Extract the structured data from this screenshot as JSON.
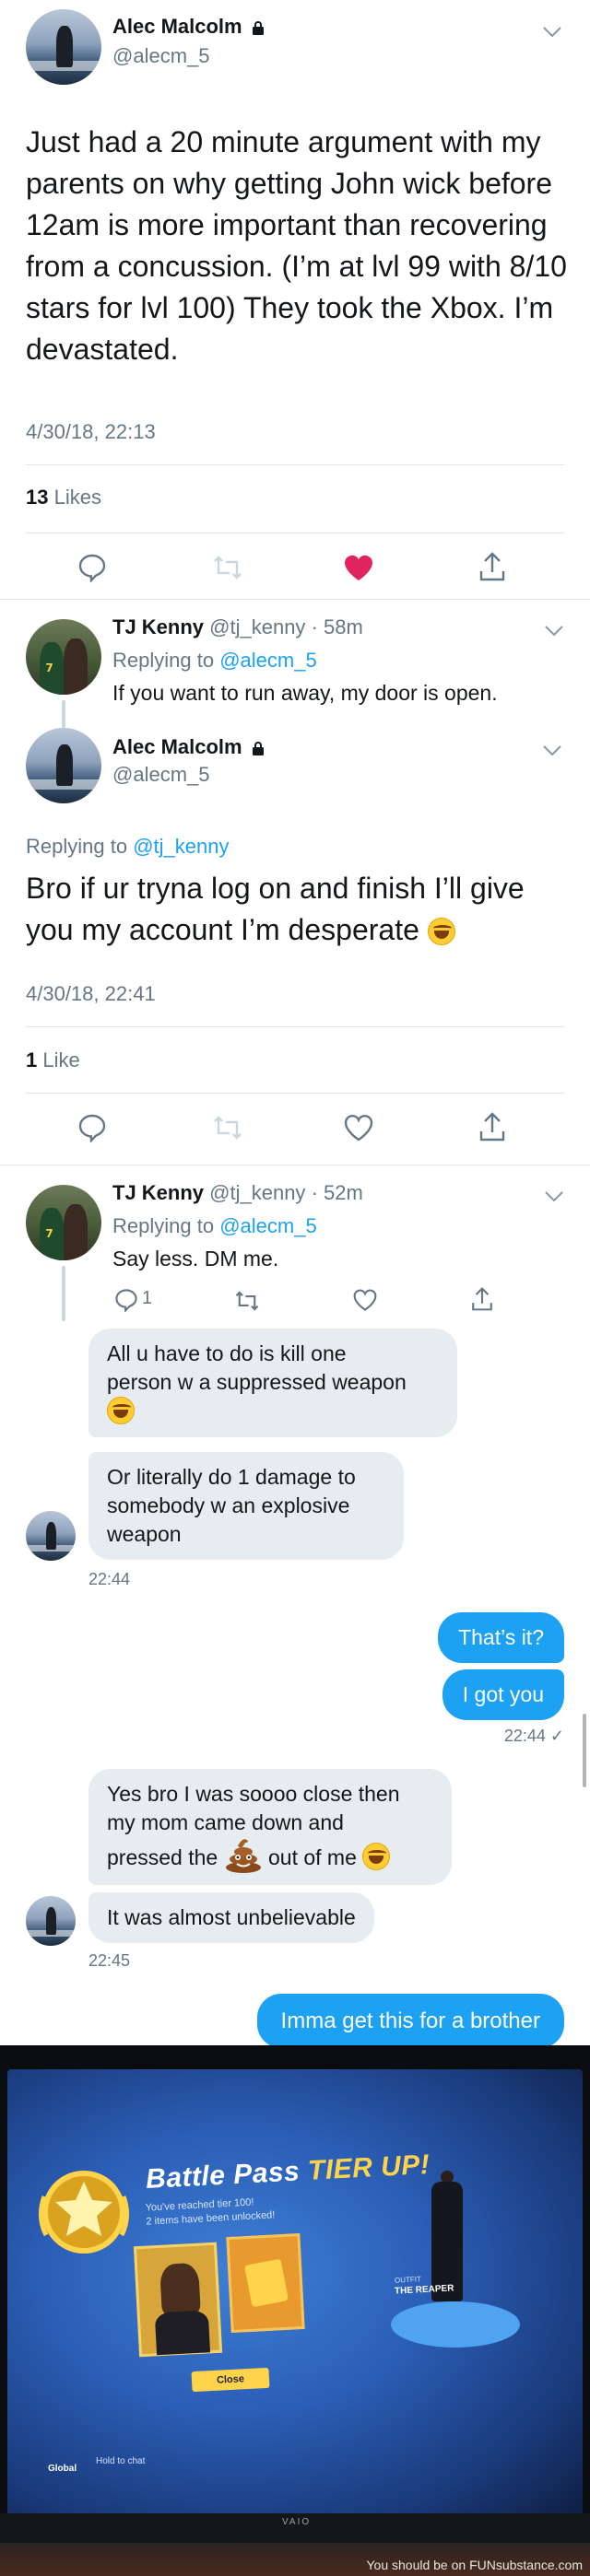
{
  "tweet1": {
    "name": "Alec Malcolm",
    "handle": "@alecm_5",
    "text": "Just had a 20 minute argument with my parents on why getting John wick before 12am is more important than recovering from a concussion. (I’m at lvl 99 with 8/10 stars for lvl 100) They took the Xbox. I’m devastated.",
    "timestamp": "4/30/18, 22:13",
    "likes_count": "13",
    "likes_label": "Likes"
  },
  "reply1": {
    "name": "TJ Kenny",
    "handle": "@tj_kenny",
    "age": "· 58m",
    "replying_prefix": "Replying to",
    "replying_to": "@alecm_5",
    "text": "If you want to run away, my door is open."
  },
  "tweet2": {
    "name": "Alec Malcolm",
    "handle": "@alecm_5",
    "replying_prefix": "Replying to",
    "replying_to": "@tj_kenny",
    "text": "Bro if ur tryna log on and finish I’ll give you my account I’m desperate",
    "timestamp": "4/30/18, 22:41",
    "likes_count": "1",
    "likes_label": "Like"
  },
  "reply2": {
    "name": "TJ Kenny",
    "handle": "@tj_kenny",
    "age": "· 52m",
    "replying_prefix": "Replying to",
    "replying_to": "@alecm_5",
    "text": "Say less. DM me.",
    "reply_count": "1"
  },
  "dm": {
    "in1_line1": "All u have to do is kill one",
    "in1_line2": "person w a suppressed weapon",
    "in2_line1": "Or literally do 1 damage to",
    "in2_line2": "somebody w an explosive",
    "in2_line3": "weapon",
    "time1": "22:44",
    "out1": "That’s it?",
    "out2": "I got you",
    "time2": "22:44 ✓",
    "in3_line1": "Yes bro I was soooo close then",
    "in3_line2": "my mom came down and",
    "in3_pre": "pressed the",
    "in3_post": "out of me",
    "in4": "It was almost unbelievable",
    "time3": "22:45",
    "out3": "Imma get this for a brother"
  },
  "photo": {
    "title_white": "Battle Pass",
    "title_gold": "TIER UP!",
    "sub1": "You've reached tier 100!",
    "sub2": "2 items have been unlocked!",
    "button": "Close",
    "outfit_label": "OUTFIT",
    "outfit_name": "THE REAPER",
    "global": "Global",
    "hold_chat": "Hold to chat",
    "brand": "VAIO",
    "watermark": "You should be on FUNsubstance.com"
  },
  "colors": {
    "accent": "#1da1f2",
    "like_red": "#e0245e",
    "secondary_text": "#657786",
    "bubble_in": "#e6ecf0"
  }
}
